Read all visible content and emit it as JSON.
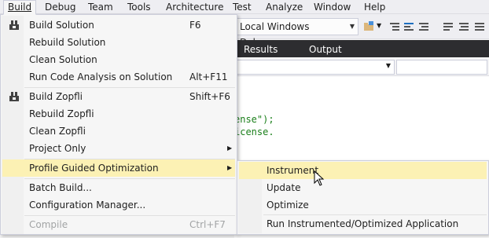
{
  "menubar": {
    "build": "Build",
    "debug": "Debug",
    "team": "Team",
    "tools": "Tools",
    "architecture": "Architecture",
    "test": "Test",
    "analyze": "Analyze",
    "window": "Window",
    "help": "Help"
  },
  "toolbar": {
    "debugger_combo": "Local Windows Debugger"
  },
  "tabs": {
    "results": "Results",
    "output": "Output"
  },
  "code": {
    "line1": "ense\");",
    "line2": "icense."
  },
  "build_menu": {
    "items": [
      {
        "label": "Build Solution",
        "shortcut": "F6"
      },
      {
        "label": "Rebuild Solution",
        "shortcut": ""
      },
      {
        "label": "Clean Solution",
        "shortcut": ""
      },
      {
        "label": "Run Code Analysis on Solution",
        "shortcut": "Alt+F11"
      },
      {
        "label": "Build Zopfli",
        "shortcut": "Shift+F6"
      },
      {
        "label": "Rebuild Zopfli",
        "shortcut": ""
      },
      {
        "label": "Clean Zopfli",
        "shortcut": ""
      },
      {
        "label": "Project Only",
        "shortcut": ""
      },
      {
        "label": "Profile Guided Optimization",
        "shortcut": ""
      },
      {
        "label": "Batch Build...",
        "shortcut": ""
      },
      {
        "label": "Configuration Manager...",
        "shortcut": ""
      },
      {
        "label": "Compile",
        "shortcut": "Ctrl+F7"
      }
    ]
  },
  "pgo_submenu": {
    "items": [
      {
        "label": "Instrument"
      },
      {
        "label": "Update"
      },
      {
        "label": "Optimize"
      },
      {
        "label": "Run Instrumented/Optimized Application"
      }
    ]
  },
  "colors": {
    "menu_highlight": "#fcf1b4",
    "tab_strip": "#2d2d30",
    "code_green": "#1a7f1a"
  }
}
